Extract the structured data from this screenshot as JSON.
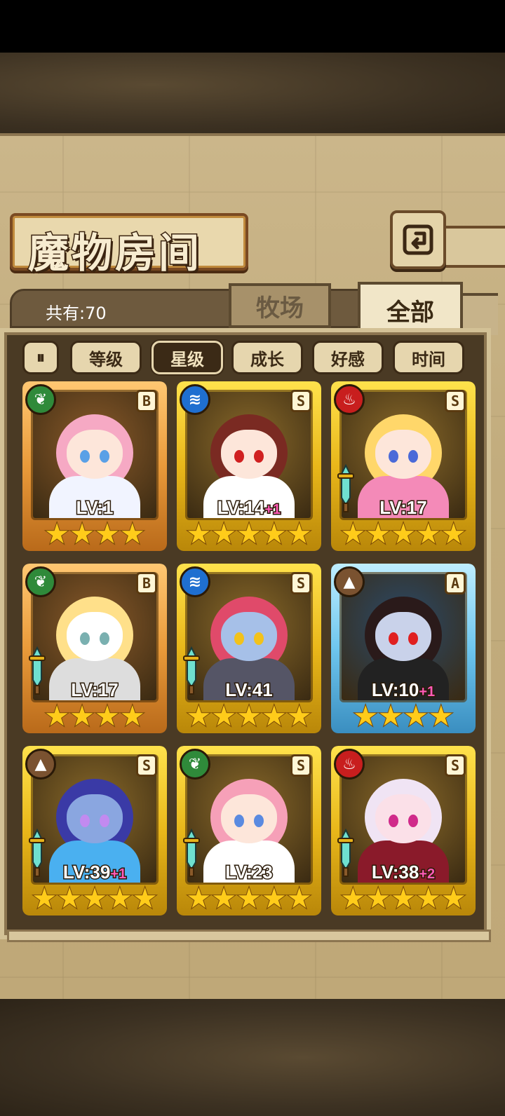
{
  "title": "魔物房间",
  "count_label": "共有:70",
  "tabs": [
    {
      "label": "牧场",
      "active": false
    },
    {
      "label": "全部",
      "active": true
    }
  ],
  "sort_toggle": "⏸",
  "filters": [
    {
      "label": "等级",
      "active": false
    },
    {
      "label": "星级",
      "active": true
    },
    {
      "label": "成长",
      "active": false
    },
    {
      "label": "好感",
      "active": false
    },
    {
      "label": "时间",
      "active": false
    }
  ],
  "monsters": [
    {
      "element": "grass",
      "element_icon": "leaf-icon",
      "rank": "B",
      "level": "LV:1",
      "bonus": "",
      "stars": 4,
      "frame": "orange",
      "has_weapon": false,
      "hair": "#f6a9c4",
      "skin": "#fde6da",
      "eye": "#5aa0e6",
      "outfit": "#f1f4ff"
    },
    {
      "element": "water",
      "element_icon": "wave-icon",
      "rank": "S",
      "level": "LV:14",
      "bonus": "+1",
      "stars": 5,
      "frame": "gold",
      "has_weapon": false,
      "hair": "#7a2a22",
      "skin": "#fde6da",
      "eye": "#d02020",
      "outfit": "#ffffff"
    },
    {
      "element": "fire",
      "element_icon": "flame-icon",
      "rank": "S",
      "level": "LV:17",
      "bonus": "",
      "stars": 5,
      "frame": "gold",
      "has_weapon": true,
      "hair": "#ffd76a",
      "skin": "#fde6da",
      "eye": "#4a6ad8",
      "outfit": "#f48ab8"
    },
    {
      "element": "grass",
      "element_icon": "leaf-icon",
      "rank": "B",
      "level": "LV:17",
      "bonus": "",
      "stars": 4,
      "frame": "orange",
      "has_weapon": true,
      "hair": "#ffe08a",
      "skin": "#ffffff",
      "eye": "#7ab0b0",
      "outfit": "#dddddd"
    },
    {
      "element": "water",
      "element_icon": "wave-icon",
      "rank": "S",
      "level": "LV:41",
      "bonus": "",
      "stars": 5,
      "frame": "gold",
      "has_weapon": true,
      "hair": "#e04a6a",
      "skin": "#a6c0e8",
      "eye": "#f2c21a",
      "outfit": "#555566"
    },
    {
      "element": "earth",
      "element_icon": "mountain-icon",
      "rank": "A",
      "level": "LV:10",
      "bonus": "+1",
      "stars": 4,
      "frame": "blue",
      "has_weapon": false,
      "hair": "#2a1a1a",
      "skin": "#c9d2ea",
      "eye": "#e02020",
      "outfit": "#222222"
    },
    {
      "element": "earth",
      "element_icon": "mountain-icon",
      "rank": "S",
      "level": "LV:39",
      "bonus": "+1",
      "stars": 5,
      "frame": "gold",
      "has_weapon": true,
      "hair": "#3a3aa6",
      "skin": "#8aa6e0",
      "eye": "#c28af0",
      "outfit": "#4ab0f0"
    },
    {
      "element": "grass",
      "element_icon": "leaf-icon",
      "rank": "S",
      "level": "LV:23",
      "bonus": "",
      "stars": 5,
      "frame": "gold",
      "has_weapon": true,
      "hair": "#f6a0b8",
      "skin": "#fde6da",
      "eye": "#5a8ae0",
      "outfit": "#ffffff"
    },
    {
      "element": "fire",
      "element_icon": "flame-icon",
      "rank": "S",
      "level": "LV:38",
      "bonus": "+2",
      "stars": 5,
      "frame": "gold",
      "has_weapon": true,
      "hair": "#f0e4f4",
      "skin": "#fbe0e8",
      "eye": "#d02a8a",
      "outfit": "#8a1a2a"
    }
  ]
}
